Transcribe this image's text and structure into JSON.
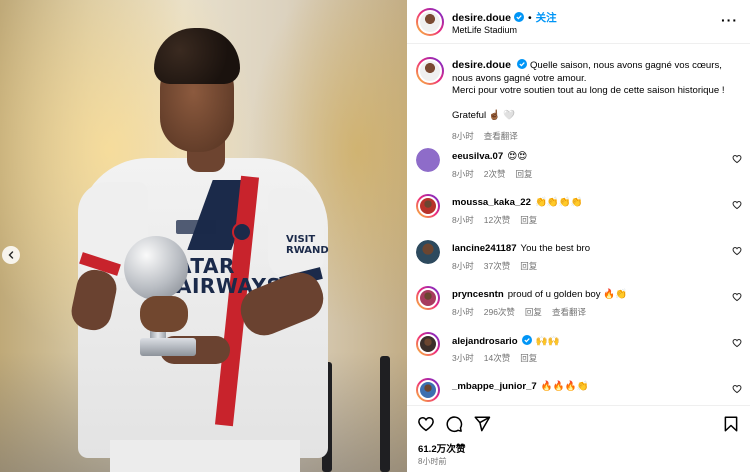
{
  "post": {
    "author": "desire.doue",
    "follow_label": "关注",
    "separator": "•",
    "location": "MetLife Stadium",
    "more_label": "···"
  },
  "photo": {
    "jersey_sponsor_line1": "ATAR",
    "jersey_sponsor_line2": "AIRWAYS",
    "sleeve_text_line1": "VISIT",
    "sleeve_text_line2": "RWAND",
    "prev_icon": "chevron-left-icon"
  },
  "caption": {
    "username": "desire.doue",
    "text": "Quelle saison, nous avons gagné vos cœurs, nous avons gagné votre amour.",
    "text2": "Merci pour votre soutien tout au long de cette saison historique !",
    "text3": "Grateful ☝🏾 🤍",
    "time": "8小时",
    "translate": "查看翻译"
  },
  "comments": [
    {
      "username": "eeusilva.07",
      "text": "😍😍",
      "time": "8小时",
      "likes": "2次赞",
      "reply": "回复",
      "translate": "",
      "verified": false,
      "avatar_color": "#8e6cc9"
    },
    {
      "username": "moussa_kaka_22",
      "text": "👏👏👏👏",
      "time": "8小时",
      "likes": "12次赞",
      "reply": "回复",
      "translate": "",
      "verified": false,
      "avatar_color": "#b8322a"
    },
    {
      "username": "lancine241187",
      "text": "You the best bro",
      "time": "8小时",
      "likes": "37次赞",
      "reply": "回复",
      "translate": "",
      "verified": false,
      "avatar_color": "#2d4a5e"
    },
    {
      "username": "pryncesntn",
      "text": "proud of u golden boy 🔥👏",
      "time": "8小时",
      "likes": "296次赞",
      "reply": "回复",
      "translate": "查看翻译",
      "verified": false,
      "avatar_color": "#a83b5e"
    },
    {
      "username": "alejandrosario",
      "text": "🙌🙌",
      "time": "3小时",
      "likes": "14次赞",
      "reply": "回复",
      "translate": "",
      "verified": true,
      "avatar_color": "#3b2e2a"
    },
    {
      "username": "_mbappe_junior_7",
      "text": "🔥🔥🔥👏",
      "time": "",
      "likes": "",
      "reply": "",
      "translate": "",
      "verified": false,
      "avatar_color": "#3c6fb0"
    }
  ],
  "footer": {
    "likes": "61.2万次赞",
    "time": "8小时前"
  },
  "colors": {
    "link": "#0095f6",
    "muted": "#737373",
    "verified": "#0095f6"
  }
}
